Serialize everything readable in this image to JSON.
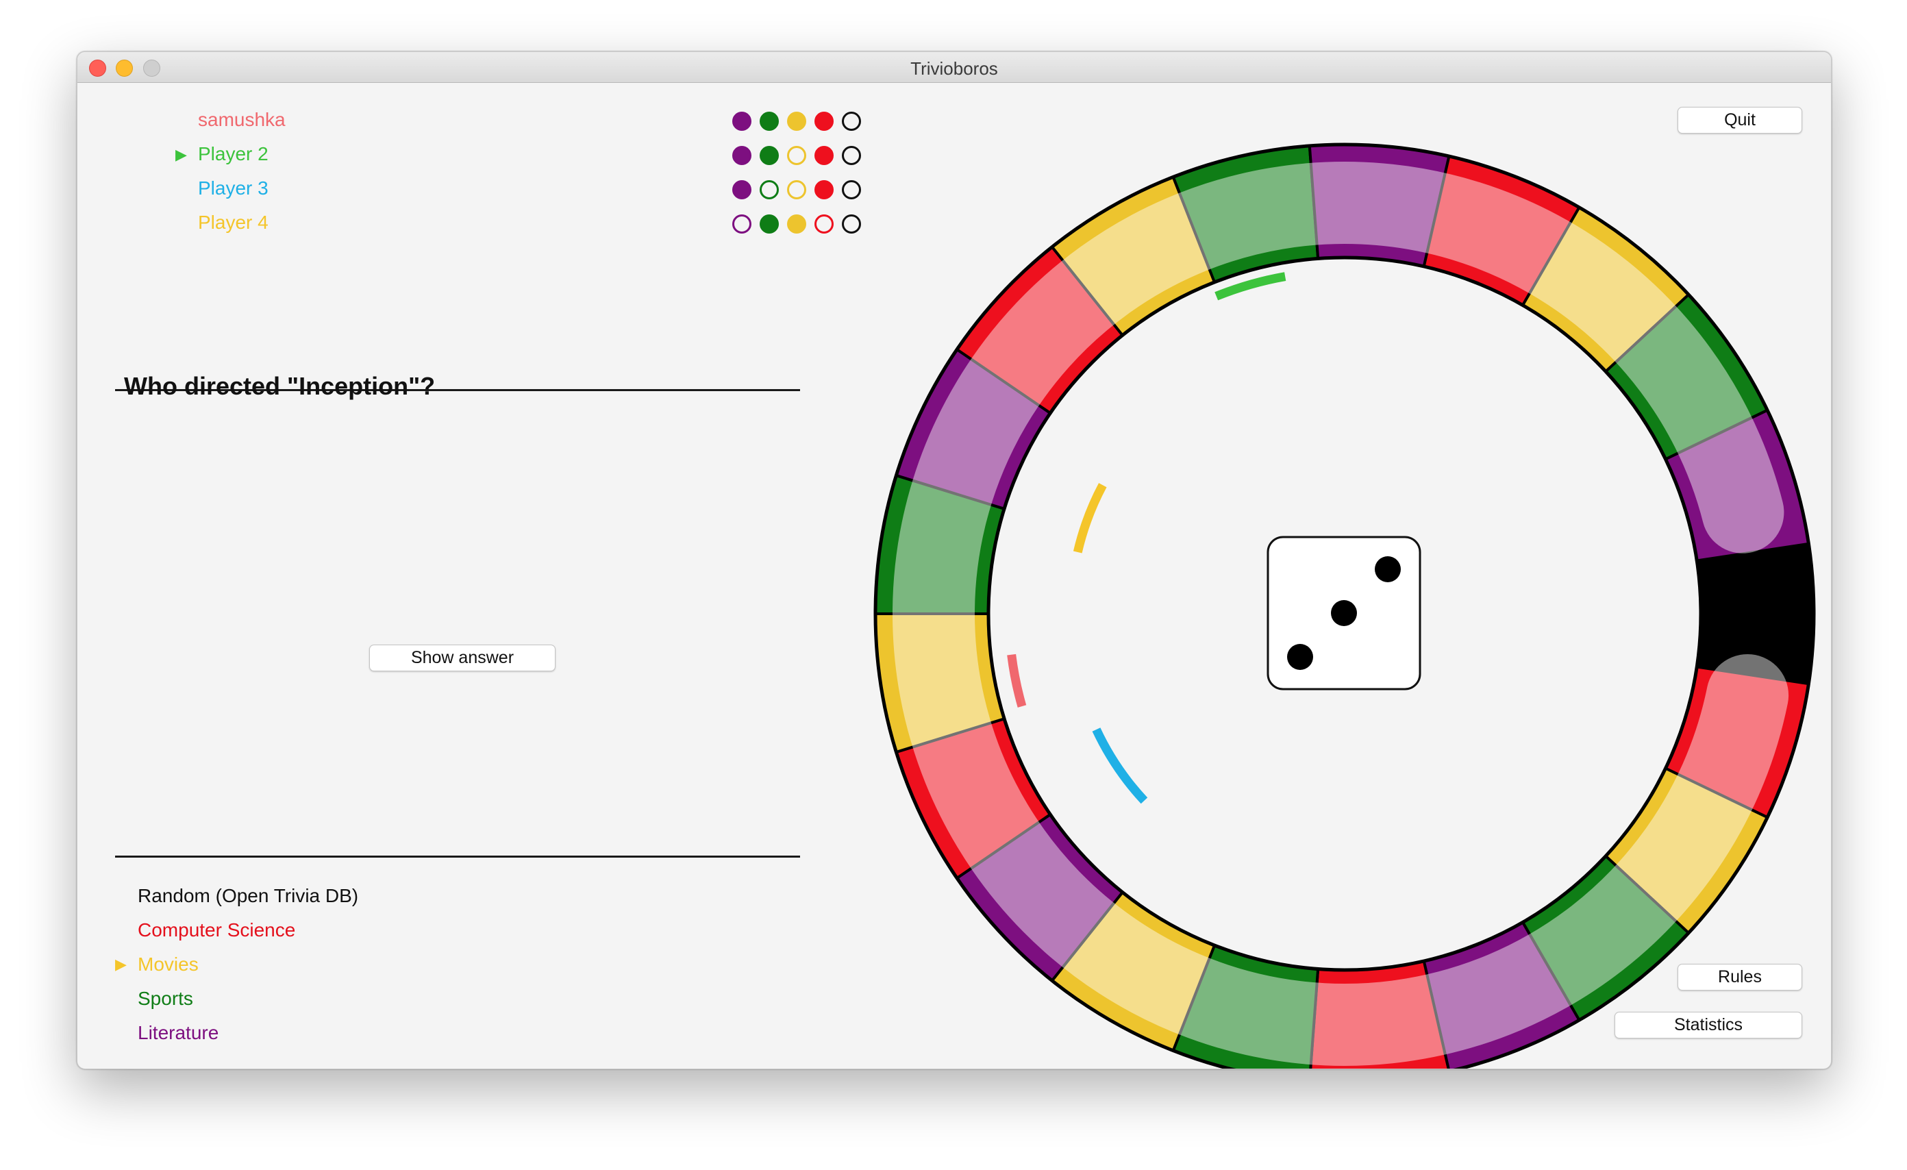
{
  "window": {
    "title": "Trivioboros"
  },
  "players": [
    {
      "name": "samushka",
      "color": "#f0686e",
      "current": false,
      "wedges": [
        {
          "color": "#7d0f80",
          "filled": true
        },
        {
          "color": "#0f7d16",
          "filled": true
        },
        {
          "color": "#edc42e",
          "filled": true
        },
        {
          "color": "#ee101e",
          "filled": true
        },
        {
          "color": "#111111",
          "filled": false
        }
      ]
    },
    {
      "name": "Player 2",
      "color": "#3cc33c",
      "current": true,
      "wedges": [
        {
          "color": "#7d0f80",
          "filled": true
        },
        {
          "color": "#0f7d16",
          "filled": true
        },
        {
          "color": "#edc42e",
          "filled": false
        },
        {
          "color": "#ee101e",
          "filled": true
        },
        {
          "color": "#111111",
          "filled": false
        }
      ]
    },
    {
      "name": "Player 3",
      "color": "#1fb0e6",
      "current": false,
      "wedges": [
        {
          "color": "#7d0f80",
          "filled": true
        },
        {
          "color": "#0f7d16",
          "filled": false
        },
        {
          "color": "#edc42e",
          "filled": false
        },
        {
          "color": "#ee101e",
          "filled": true
        },
        {
          "color": "#111111",
          "filled": false
        }
      ]
    },
    {
      "name": "Player 4",
      "color": "#f4c52a",
      "current": false,
      "wedges": [
        {
          "color": "#7d0f80",
          "filled": false
        },
        {
          "color": "#0f7d16",
          "filled": true
        },
        {
          "color": "#edc42e",
          "filled": true
        },
        {
          "color": "#ee101e",
          "filled": false
        },
        {
          "color": "#111111",
          "filled": false
        }
      ]
    }
  ],
  "question": {
    "text": "Who directed \"Inception\"?"
  },
  "buttons": {
    "show_answer": "Show answer",
    "quit": "Quit",
    "rules": "Rules",
    "statistics": "Statistics"
  },
  "categories": [
    {
      "label": "Random (Open Trivia DB)",
      "color": "#111111",
      "selected": false
    },
    {
      "label": "Computer Science",
      "color": "#e4101c",
      "selected": false
    },
    {
      "label": "Movies",
      "color": "#f4c52a",
      "selected": true
    },
    {
      "label": "Sports",
      "color": "#0f7d16",
      "selected": false
    },
    {
      "label": "Literature",
      "color": "#7d0f80",
      "selected": false
    }
  ],
  "board": {
    "palette": {
      "red": "#ee101e",
      "purple": "#7d0f80",
      "green": "#0f7d16",
      "yellow": "#edc42e",
      "black": "#000000"
    },
    "die_value": 3,
    "squares_clockwise_from_bottom_right": [
      "red",
      "yellow",
      "green",
      "purple",
      "red",
      "green",
      "yellow",
      "purple",
      "red",
      "yellow",
      "green",
      "purple",
      "red",
      "yellow",
      "green",
      "purple",
      "red",
      "yellow",
      "green",
      "purple",
      "black"
    ]
  }
}
